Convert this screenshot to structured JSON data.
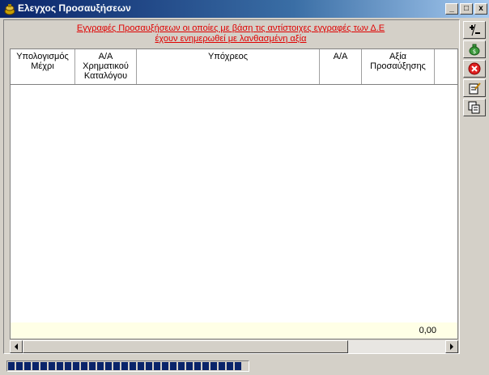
{
  "window": {
    "title": "Ελεγχος Προσαυξήσεων",
    "controls": {
      "minimize": "_",
      "maximize": "□",
      "close": "x"
    }
  },
  "notice": {
    "line1": "Εγγραφές Προσαυξήσεων οι οποίες με βάση τις αντίστοιχες εγγραφές των Δ.Ε",
    "line2": "έχουν ενημερωθεί με λανθασμένη  αξία"
  },
  "grid": {
    "columns": [
      {
        "key": "calc_until",
        "label": "Υπολογισμός\nΜέχρι"
      },
      {
        "key": "aa_catalog",
        "label": "Α/Α\nΧρηματικού\nΚαταλόγου"
      },
      {
        "key": "obligor",
        "label": "Υπόχρεος"
      },
      {
        "key": "aa",
        "label": "Α/Α"
      },
      {
        "key": "surcharge_value",
        "label": "Αξία\nΠροσαύξησης"
      },
      {
        "key": "extra",
        "label": ""
      }
    ],
    "rows": [],
    "total": "0,00"
  },
  "toolbar": {
    "buttons": [
      {
        "name": "plus-minus-button",
        "icon": "plus-minus-icon"
      },
      {
        "name": "money-bag-button",
        "icon": "money-bag-icon"
      },
      {
        "name": "cancel-button",
        "icon": "cancel-icon"
      },
      {
        "name": "edit-button",
        "icon": "edit-icon"
      },
      {
        "name": "copy-button",
        "icon": "copy-icon"
      }
    ]
  },
  "status": {
    "progress_percent": 100
  },
  "colors": {
    "titlebar_start": "#0a246a",
    "notice_text": "#e00000",
    "total_row_bg": "#ffffe6",
    "progress": "#0a246a"
  }
}
